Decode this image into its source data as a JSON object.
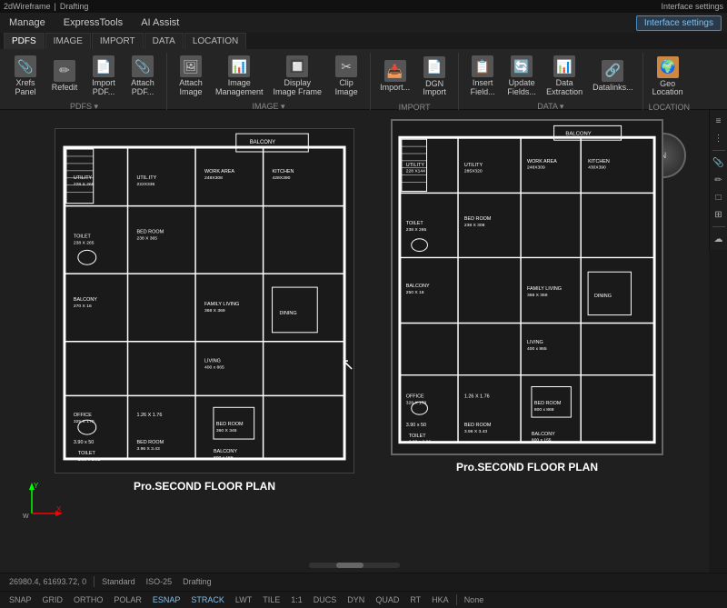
{
  "topbar": {
    "items": [
      "2dWireframe",
      "Drafting"
    ]
  },
  "title_bar": {
    "menus": [
      "Manage",
      "ExpressTools",
      "AI Assist"
    ],
    "interface_settings": "Interface settings"
  },
  "ribbon": {
    "tabs": [
      "PDFS",
      "IMAGE",
      "IMPORT",
      "DATA",
      "LOCATION"
    ],
    "groups": [
      {
        "name": "PDFS",
        "label": "PDFS ▾",
        "buttons": [
          {
            "icon": "📎",
            "label": "Xrefs\nPanel",
            "small": false
          },
          {
            "icon": "📄",
            "label": "Refedit",
            "small": false
          },
          {
            "icon": "📥",
            "label": "Import\nPDF...",
            "small": false
          },
          {
            "icon": "📎",
            "label": "Attach\nPDF...",
            "small": false
          }
        ]
      },
      {
        "name": "IMAGE",
        "label": "IMAGE ▾",
        "buttons": [
          {
            "icon": "🖼",
            "label": "Attach\nImage",
            "small": false
          },
          {
            "icon": "📊",
            "label": "Image\nManagement",
            "small": false
          },
          {
            "icon": "🔲",
            "label": "Display\nImage Frame",
            "small": false
          },
          {
            "icon": "✂",
            "label": "Clip\nImage",
            "small": false
          }
        ]
      },
      {
        "name": "IMPORT",
        "label": "IMPORT",
        "buttons": [
          {
            "icon": "📥",
            "label": "Import...",
            "small": false
          },
          {
            "icon": "📄",
            "label": "DGN\nImport",
            "small": false
          }
        ]
      },
      {
        "name": "DATA",
        "label": "DATA ▾",
        "buttons": [
          {
            "icon": "📋",
            "label": "Insert\nField...",
            "small": false
          },
          {
            "icon": "🔄",
            "label": "Update\nFields...",
            "small": false
          },
          {
            "icon": "📊",
            "label": "Data\nExtraction",
            "small": false
          },
          {
            "icon": "🔗",
            "label": "Datalinks...",
            "small": false
          }
        ]
      },
      {
        "name": "LOCATION",
        "label": "LOCATION",
        "buttons": [
          {
            "icon": "🌍",
            "label": "Geo\nLocation",
            "small": false
          }
        ]
      }
    ]
  },
  "canvas": {
    "cursor_position": "26980.4, 61693.72, 0",
    "plan_title_left": "Pro.SECOND  FLOOR PLAN",
    "plan_title_right": "Pro.SECOND  FLOOR PLAN"
  },
  "right_toolbar": {
    "tools": [
      "≡",
      "⋮",
      "📎",
      "✏",
      "□",
      "⊕",
      "☁"
    ]
  },
  "status_bar": {
    "coordinates": "26980.4, 61693.72, 0",
    "model": "Standard",
    "profile": "ISO-25",
    "drawing_mode": "Drafting",
    "toggles": [
      "SNAP",
      "GRID",
      "ORTHO",
      "POLAR",
      "ESNAP",
      "STRACK",
      "LWT",
      "TILE",
      "1:1",
      "DUCS",
      "DYN",
      "QUAD",
      "RT",
      "HKA"
    ],
    "active_toggles": [
      "ESNAP",
      "STRACK"
    ],
    "right_status": "None"
  }
}
